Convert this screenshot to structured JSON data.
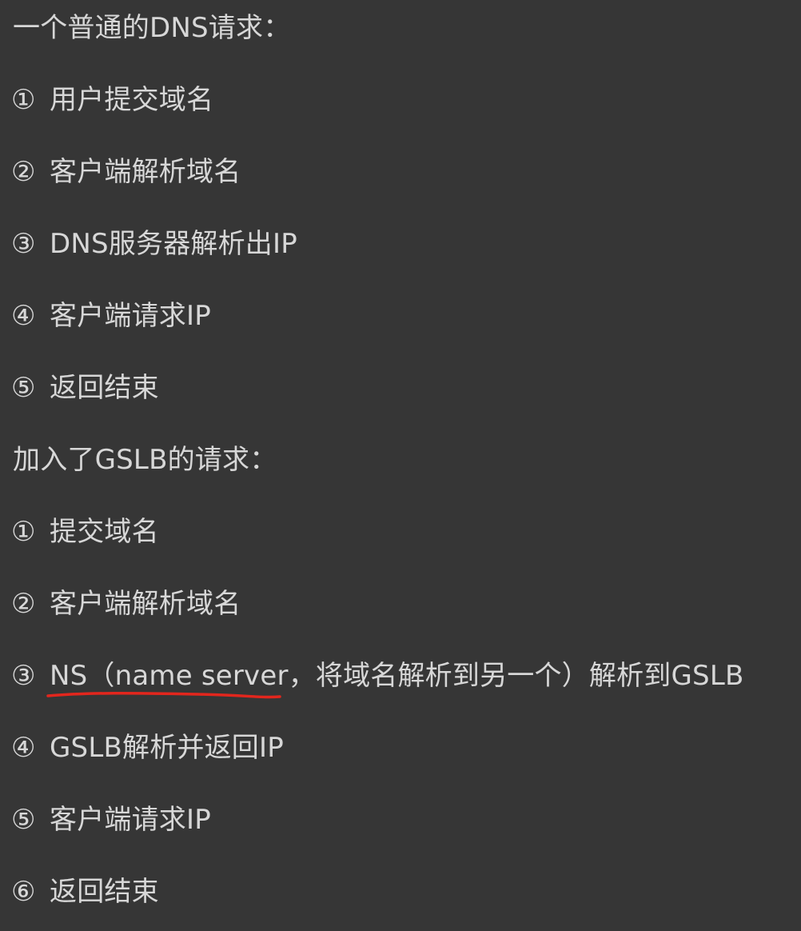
{
  "normal": {
    "title": "一个普通的DNS请求：",
    "steps": [
      {
        "num": "①",
        "text": "用户提交域名"
      },
      {
        "num": "②",
        "text": "客户端解析域名"
      },
      {
        "num": "③",
        "text": "DNS服务器解析出IP"
      },
      {
        "num": "④",
        "text": "客户端请求IP"
      },
      {
        "num": "⑤",
        "text": "返回结束"
      }
    ]
  },
  "gslb": {
    "title": "加入了GSLB的请求：",
    "steps": [
      {
        "num": "①",
        "text": "提交域名"
      },
      {
        "num": "②",
        "text": "客户端解析域名"
      },
      {
        "num": "③",
        "underlined": "NS（name server",
        "rest": "，将域名解析到另一个）解析到GSLB"
      },
      {
        "num": "④",
        "text": "GSLB解析并返回IP"
      },
      {
        "num": "⑤",
        "text": "客户端请求IP"
      },
      {
        "num": "⑥",
        "text": "返回结束"
      }
    ]
  },
  "colors": {
    "background": "#363636",
    "text": "#d7d7d7",
    "annotation_stroke": "#e3261d"
  }
}
